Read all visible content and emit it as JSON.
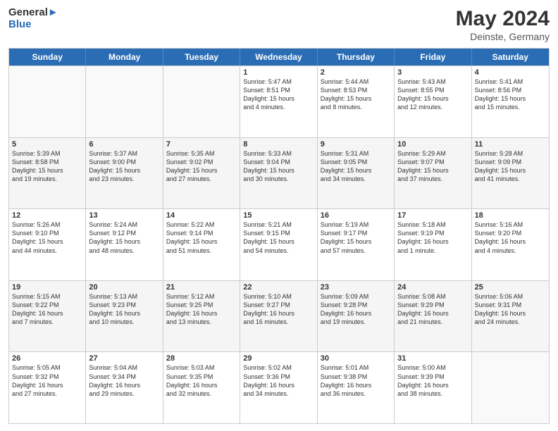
{
  "header": {
    "logo_general": "General",
    "logo_blue": "Blue",
    "main_title": "May 2024",
    "subtitle": "Deinste, Germany"
  },
  "weekdays": [
    "Sunday",
    "Monday",
    "Tuesday",
    "Wednesday",
    "Thursday",
    "Friday",
    "Saturday"
  ],
  "weeks": [
    [
      {
        "day": "",
        "info": ""
      },
      {
        "day": "",
        "info": ""
      },
      {
        "day": "",
        "info": ""
      },
      {
        "day": "1",
        "info": "Sunrise: 5:47 AM\nSunset: 8:51 PM\nDaylight: 15 hours\nand 4 minutes."
      },
      {
        "day": "2",
        "info": "Sunrise: 5:44 AM\nSunset: 8:53 PM\nDaylight: 15 hours\nand 8 minutes."
      },
      {
        "day": "3",
        "info": "Sunrise: 5:43 AM\nSunset: 8:55 PM\nDaylight: 15 hours\nand 12 minutes."
      },
      {
        "day": "4",
        "info": "Sunrise: 5:41 AM\nSunset: 8:56 PM\nDaylight: 15 hours\nand 15 minutes."
      }
    ],
    [
      {
        "day": "5",
        "info": "Sunrise: 5:39 AM\nSunset: 8:58 PM\nDaylight: 15 hours\nand 19 minutes."
      },
      {
        "day": "6",
        "info": "Sunrise: 5:37 AM\nSunset: 9:00 PM\nDaylight: 15 hours\nand 23 minutes."
      },
      {
        "day": "7",
        "info": "Sunrise: 5:35 AM\nSunset: 9:02 PM\nDaylight: 15 hours\nand 27 minutes."
      },
      {
        "day": "8",
        "info": "Sunrise: 5:33 AM\nSunset: 9:04 PM\nDaylight: 15 hours\nand 30 minutes."
      },
      {
        "day": "9",
        "info": "Sunrise: 5:31 AM\nSunset: 9:05 PM\nDaylight: 15 hours\nand 34 minutes."
      },
      {
        "day": "10",
        "info": "Sunrise: 5:29 AM\nSunset: 9:07 PM\nDaylight: 15 hours\nand 37 minutes."
      },
      {
        "day": "11",
        "info": "Sunrise: 5:28 AM\nSunset: 9:09 PM\nDaylight: 15 hours\nand 41 minutes."
      }
    ],
    [
      {
        "day": "12",
        "info": "Sunrise: 5:26 AM\nSunset: 9:10 PM\nDaylight: 15 hours\nand 44 minutes."
      },
      {
        "day": "13",
        "info": "Sunrise: 5:24 AM\nSunset: 9:12 PM\nDaylight: 15 hours\nand 48 minutes."
      },
      {
        "day": "14",
        "info": "Sunrise: 5:22 AM\nSunset: 9:14 PM\nDaylight: 15 hours\nand 51 minutes."
      },
      {
        "day": "15",
        "info": "Sunrise: 5:21 AM\nSunset: 9:15 PM\nDaylight: 15 hours\nand 54 minutes."
      },
      {
        "day": "16",
        "info": "Sunrise: 5:19 AM\nSunset: 9:17 PM\nDaylight: 15 hours\nand 57 minutes."
      },
      {
        "day": "17",
        "info": "Sunrise: 5:18 AM\nSunset: 9:19 PM\nDaylight: 16 hours\nand 1 minute."
      },
      {
        "day": "18",
        "info": "Sunrise: 5:16 AM\nSunset: 9:20 PM\nDaylight: 16 hours\nand 4 minutes."
      }
    ],
    [
      {
        "day": "19",
        "info": "Sunrise: 5:15 AM\nSunset: 9:22 PM\nDaylight: 16 hours\nand 7 minutes."
      },
      {
        "day": "20",
        "info": "Sunrise: 5:13 AM\nSunset: 9:23 PM\nDaylight: 16 hours\nand 10 minutes."
      },
      {
        "day": "21",
        "info": "Sunrise: 5:12 AM\nSunset: 9:25 PM\nDaylight: 16 hours\nand 13 minutes."
      },
      {
        "day": "22",
        "info": "Sunrise: 5:10 AM\nSunset: 9:27 PM\nDaylight: 16 hours\nand 16 minutes."
      },
      {
        "day": "23",
        "info": "Sunrise: 5:09 AM\nSunset: 9:28 PM\nDaylight: 16 hours\nand 19 minutes."
      },
      {
        "day": "24",
        "info": "Sunrise: 5:08 AM\nSunset: 9:29 PM\nDaylight: 16 hours\nand 21 minutes."
      },
      {
        "day": "25",
        "info": "Sunrise: 5:06 AM\nSunset: 9:31 PM\nDaylight: 16 hours\nand 24 minutes."
      }
    ],
    [
      {
        "day": "26",
        "info": "Sunrise: 5:05 AM\nSunset: 9:32 PM\nDaylight: 16 hours\nand 27 minutes."
      },
      {
        "day": "27",
        "info": "Sunrise: 5:04 AM\nSunset: 9:34 PM\nDaylight: 16 hours\nand 29 minutes."
      },
      {
        "day": "28",
        "info": "Sunrise: 5:03 AM\nSunset: 9:35 PM\nDaylight: 16 hours\nand 32 minutes."
      },
      {
        "day": "29",
        "info": "Sunrise: 5:02 AM\nSunset: 9:36 PM\nDaylight: 16 hours\nand 34 minutes."
      },
      {
        "day": "30",
        "info": "Sunrise: 5:01 AM\nSunset: 9:38 PM\nDaylight: 16 hours\nand 36 minutes."
      },
      {
        "day": "31",
        "info": "Sunrise: 5:00 AM\nSunset: 9:39 PM\nDaylight: 16 hours\nand 38 minutes."
      },
      {
        "day": "",
        "info": ""
      }
    ]
  ]
}
